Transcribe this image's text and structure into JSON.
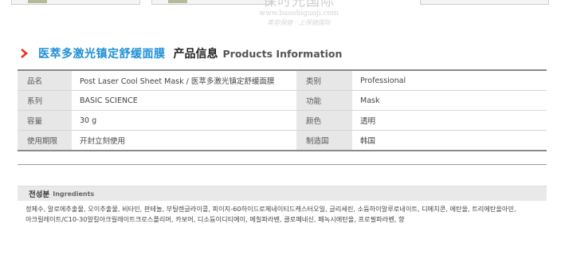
{
  "watermark": {
    "name": "保时光国际",
    "url": "www.baoshiguoji.com",
    "slogan": "美容保健 · 上保健国际"
  },
  "section": {
    "product_name_cn": "医萃多激光镇定舒缓面膜",
    "title_cn": "产品信息",
    "title_en": "Products Information",
    "accent_color": "#1e8fd6"
  },
  "info_rows": [
    {
      "k1": "品名",
      "v1": "Post Laser Cool Sheet Mask / 医萃多激光镇定舒缓面膜",
      "k2": "类别",
      "v2": "Professional"
    },
    {
      "k1": "系列",
      "v1": "BASIC SCIENCE",
      "k2": "功能",
      "v2": "Mask"
    },
    {
      "k1": "容量",
      "v1": "30 g",
      "k2": "颜色",
      "v2": "透明"
    },
    {
      "k1": "使用期限",
      "v1": "开封立刻使用",
      "k2": "制造国",
      "v2": "韩国"
    }
  ],
  "ingredients": {
    "title_kr": "전성분",
    "title_en": "Ingredients",
    "lines": [
      "정제수, 알로에추출물, 오이추출물, 비타민, 판테놀, 부틸렌글라이콜, 피이지-60하이드로제네이티드캐스터오일, 글리세린, 소듐하이알루로네이트, 디메치콘, 에탄올, 트리에탄올아민,",
      "아크릴레이트/C10-30알킬아크릴레이트크로스폴리머, 카보머, 디소듐이디티에이, 메칠파라벤, 클로페네신, 페녹시에탄올, 프로필파라벤, 향"
    ]
  }
}
